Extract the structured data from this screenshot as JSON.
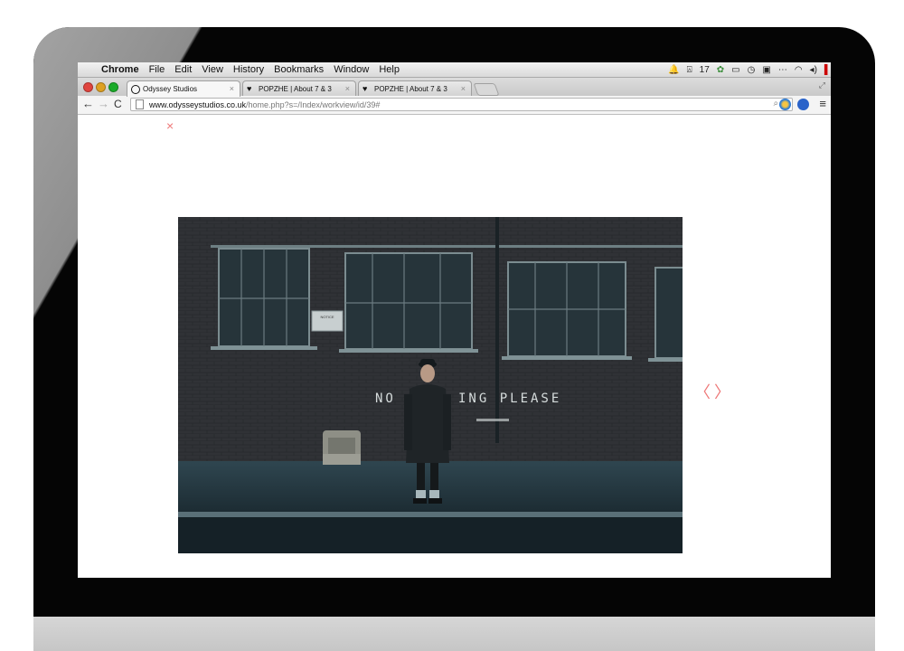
{
  "menubar": {
    "apple_icon": "apple-icon",
    "app_name": "Chrome",
    "items": [
      "File",
      "Edit",
      "View",
      "History",
      "Bookmarks",
      "Window",
      "Help"
    ],
    "battery_text": "17"
  },
  "tabs": [
    {
      "title": "Odyssey Studios",
      "active": true
    },
    {
      "title": "POPZHE | About 7 & 3",
      "active": false
    },
    {
      "title": "POPZHE | About 7 & 3",
      "active": false
    }
  ],
  "toolbar": {
    "url_host": "www.odysseystudios.co.uk",
    "url_path": "/home.php?s=/Index/workview/id/39#"
  },
  "page": {
    "close_glyph": "×",
    "prev_glyph": "〈",
    "next_glyph": "〉",
    "wall_text_left": "NO",
    "wall_text_right": "ING PLEASE",
    "notice_text": "NOTICE"
  },
  "colors": {
    "accent": "#e77777",
    "photo_teal": "#1e2a2e"
  }
}
